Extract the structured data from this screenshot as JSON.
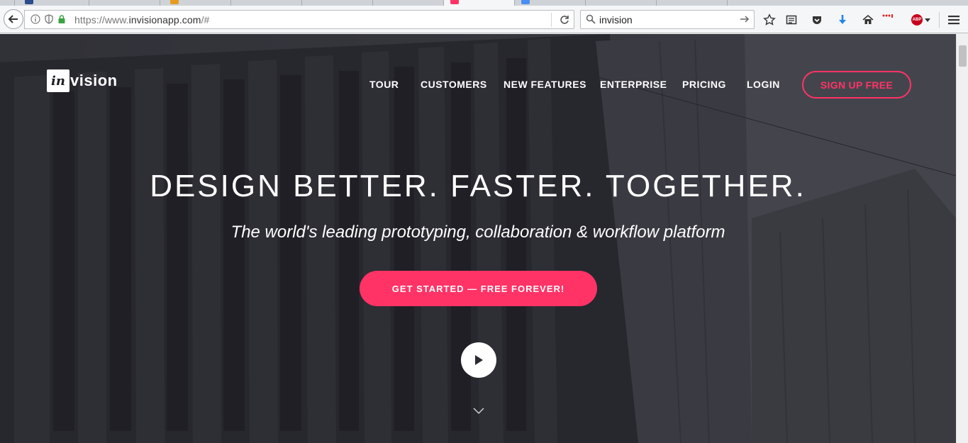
{
  "browser": {
    "url_secure_part": "https://www.",
    "url_host": "invisionapp.com",
    "url_rest": "/#",
    "search_value": "invision"
  },
  "site": {
    "logo_box": "in",
    "logo_rest": "vision",
    "nav": {
      "tour": "TOUR",
      "customers": "CUSTOMERS",
      "new_features": "NEW FEATURES",
      "enterprise": "ENTERPRISE",
      "pricing": "PRICING",
      "login": "LOGIN",
      "signup": "SIGN UP FREE"
    },
    "hero": {
      "headline": "DESIGN BETTER. FASTER. TOGETHER.",
      "tagline": "The world's leading prototyping, collaboration & workflow platform",
      "cta": "GET STARTED — FREE FOREVER!"
    }
  },
  "colors": {
    "accent": "#ff3366",
    "overlay": "#2b2b31"
  },
  "icons": [
    "back-arrow-icon",
    "info-icon",
    "shield-icon",
    "lock-icon",
    "reload-icon",
    "search-icon",
    "search-go-icon",
    "bookmark-star-icon",
    "reading-list-icon",
    "pocket-icon",
    "download-icon",
    "home-icon",
    "extension-dots-icon",
    "adblock-icon",
    "menu-icon",
    "play-icon",
    "chevron-down-icon"
  ]
}
